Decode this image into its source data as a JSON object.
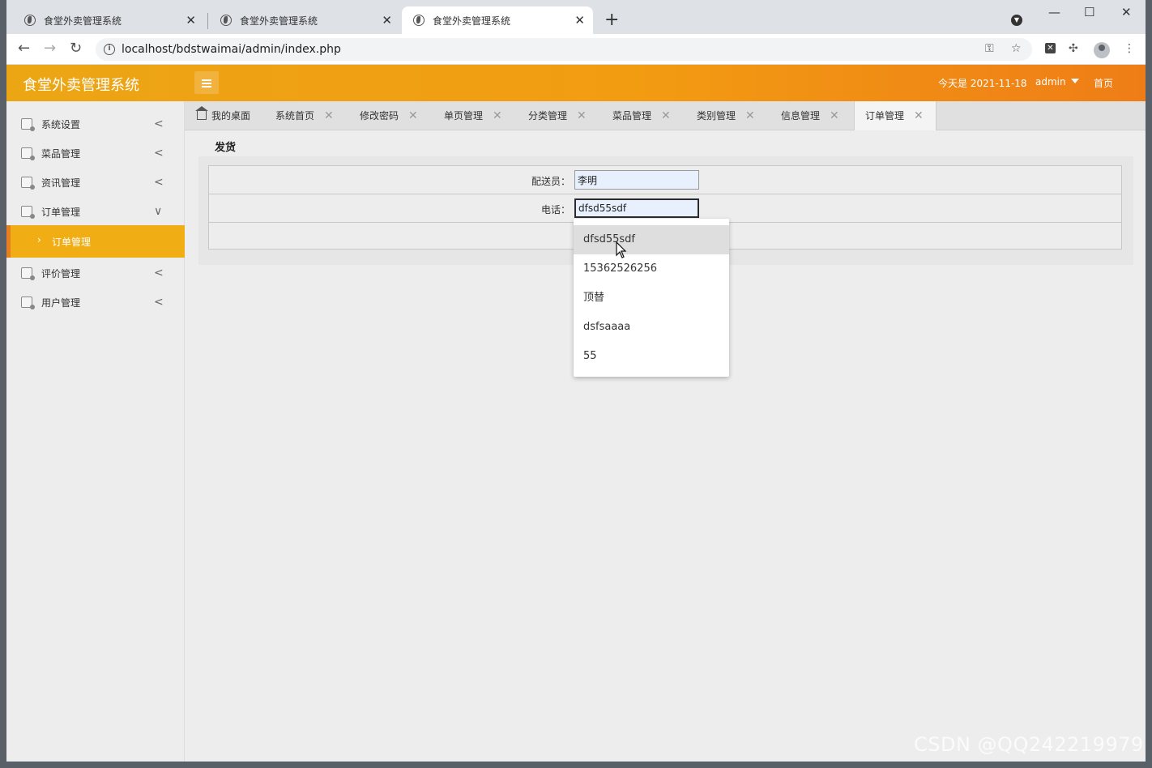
{
  "browser": {
    "tabs": [
      {
        "title": "食堂外卖管理系统"
      },
      {
        "title": "食堂外卖管理系统"
      },
      {
        "title": "食堂外卖管理系统"
      }
    ],
    "new_tab": "+",
    "url": "localhost/bdstwaimai/admin/index.php"
  },
  "header": {
    "title": "食堂外卖管理系统",
    "date_text": "今天是 2021-11-18",
    "user": "admin",
    "home": "首页"
  },
  "sidebar": {
    "items": [
      {
        "label": "系统设置",
        "arrow": "<"
      },
      {
        "label": "菜品管理",
        "arrow": "<"
      },
      {
        "label": "资讯管理",
        "arrow": "<"
      },
      {
        "label": "订单管理",
        "arrow": "∨"
      },
      {
        "label": "评价管理",
        "arrow": "<"
      },
      {
        "label": "用户管理",
        "arrow": "<"
      }
    ],
    "active_sub": "订单管理"
  },
  "page_tabs": [
    {
      "label": "我的桌面"
    },
    {
      "label": "系统首页"
    },
    {
      "label": "修改密码"
    },
    {
      "label": "单页管理"
    },
    {
      "label": "分类管理"
    },
    {
      "label": "菜品管理"
    },
    {
      "label": "类别管理"
    },
    {
      "label": "信息管理"
    },
    {
      "label": "订单管理"
    }
  ],
  "form": {
    "title": "发货",
    "courier_label": "配送员：",
    "courier_value": "李明",
    "phone_label": "电话：",
    "phone_value": "dfsd55sdf"
  },
  "autocomplete": [
    "dfsd55sdf",
    "15362526256",
    "顶替",
    "dsfsaaaa",
    "55"
  ],
  "watermark": "CSDN @QQ242219979"
}
